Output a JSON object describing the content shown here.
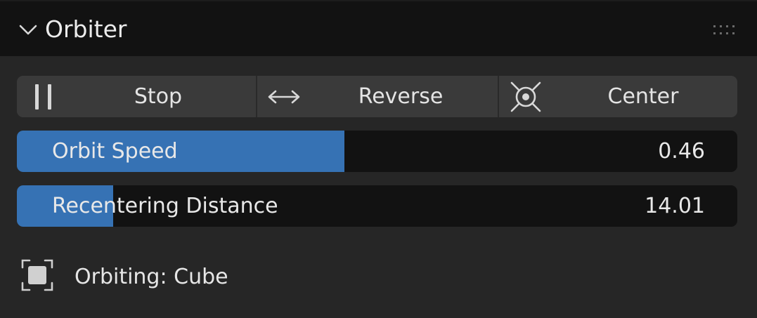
{
  "panel": {
    "title": "Orbiter",
    "collapse_icon": "chevron-down-icon",
    "drag_icon": "drag-grip-icon"
  },
  "buttons": [
    {
      "label": "Stop",
      "icon": "pause-icon"
    },
    {
      "label": "Reverse",
      "icon": "double-arrow-horizontal-icon"
    },
    {
      "label": "Center",
      "icon": "crosshair-target-icon"
    }
  ],
  "sliders": [
    {
      "label": "Orbit Speed",
      "value": "0.46",
      "fill_fraction": 0.455
    },
    {
      "label": "Recentering Distance",
      "value": "14.01",
      "fill_fraction": 0.134
    }
  ],
  "status": {
    "label": "Orbiting: Cube",
    "icon": "object-select-icon"
  },
  "colors": {
    "accent": "#3672b4",
    "header_bg": "#121212",
    "panel_bg": "#262626",
    "button_bg": "#3a3a3a",
    "slider_bg": "#121212"
  }
}
